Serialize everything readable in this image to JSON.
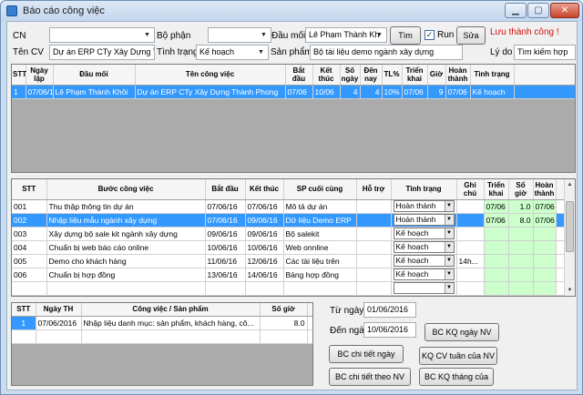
{
  "window": {
    "title": "Báo cáo công việc"
  },
  "filters": {
    "cn_label": "CN",
    "cn_value": "",
    "bophan_label": "Bộ phận",
    "bophan_value": "",
    "daumoi_label": "Đầu mối",
    "daumoi_value": "Lê Phạm Thành Kh",
    "tim_button": "Tìm",
    "run_label": "Run",
    "run_checked": "✓",
    "sua_button": "Sửa",
    "save_status": "Lưu thành công !",
    "tencv_label": "Tên CV",
    "tencv_value": "Dự án ERP CTy Xây Dựng Thà",
    "tinhtrang_label": "Tình trạng",
    "tinhtrang_value": "Kế hoạch",
    "sanpham_label": "Sản phẩm",
    "sanpham_value": "Bộ tài liệu demo ngành xây dựng",
    "lydo_label": "Lý do",
    "lydo_value": "Tìm kiếm hợp"
  },
  "grid1": {
    "headers": [
      "STT",
      "Ngày lập",
      "Đầu mối",
      "Tên công việc",
      "Bắt đầu",
      "Kết thúc",
      "Số ngày",
      "Đến nay",
      "TL%",
      "Triển khai",
      "Giờ",
      "Hoàn thành",
      "Tình trạng"
    ],
    "rows": [
      [
        "1",
        "07/06/16",
        "Lê Phạm Thành Khôi",
        "Dự án ERP CTy Xây Dựng Thành Phong",
        "07/06",
        "10/06",
        "4",
        "4",
        "10%",
        "07/06",
        "9",
        "07/06",
        "Kế hoạch"
      ]
    ]
  },
  "grid2": {
    "headers": [
      "STT",
      "Bước công việc",
      "Bắt đầu",
      "Kết thúc",
      "SP cuối cùng",
      "Hỗ trợ",
      "Tình trạng",
      "Ghi chú",
      "Triển khai",
      "Số giờ",
      "Hoàn thành"
    ],
    "rows": [
      [
        "001",
        "Thu thập thông tin dự án",
        "07/06/16",
        "07/06/16",
        "Mô tả dự án",
        "",
        "Hoàn thành",
        "",
        "07/06",
        "1.0",
        "07/06"
      ],
      [
        "002",
        "Nhập liệu mẫu ngành xây dựng",
        "07/06/16",
        "09/06/16",
        "Dữ liệu Demo ERP",
        "",
        "Hoàn thành",
        "",
        "07/06",
        "8.0",
        "07/06"
      ],
      [
        "003",
        "Xây dựng bộ sale kit ngành xây dựng",
        "09/06/16",
        "09/06/16",
        "Bộ salekit",
        "",
        "Kế hoạch",
        "",
        "",
        "",
        ""
      ],
      [
        "004",
        "Chuẩn bị web báo cáo online",
        "10/06/16",
        "10/06/16",
        "Web onnline",
        "",
        "Kế hoạch",
        "",
        "",
        "",
        ""
      ],
      [
        "005",
        "Demo cho khách hàng",
        "11/06/16",
        "12/06/16",
        "Các tài liệu trên",
        "",
        "Kế hoạch",
        "14h...",
        "",
        "",
        ""
      ],
      [
        "006",
        "Chuẩn bị hợp đồng",
        "13/06/16",
        "14/06/16",
        "Bảng hợp đồng",
        "",
        "Kế hoạch",
        "",
        "",
        "",
        ""
      ]
    ]
  },
  "grid3": {
    "headers": [
      "STT",
      "Ngày TH",
      "Công việc / Sản phẩm",
      "Số giờ"
    ],
    "rows": [
      [
        "1",
        "07/06/2016",
        "Nhập liệu danh mục: sản phẩm, khách hàng, cô...",
        "8.0"
      ]
    ]
  },
  "report": {
    "tungay_label": "Từ ngày",
    "tungay_value": "01/06/2016",
    "denngay_label": "Đến ngày",
    "denngay_value": "10/06/2016",
    "btn_kq_ngay": "BC KQ ngày NV",
    "btn_ct_ngay": "BC chi tiết ngày",
    "btn_cv_tuan": "KQ CV tuần của NV",
    "btn_ct_nv": "BC chi tiết theo NV",
    "btn_kq_thang": "BC KQ tháng của"
  }
}
